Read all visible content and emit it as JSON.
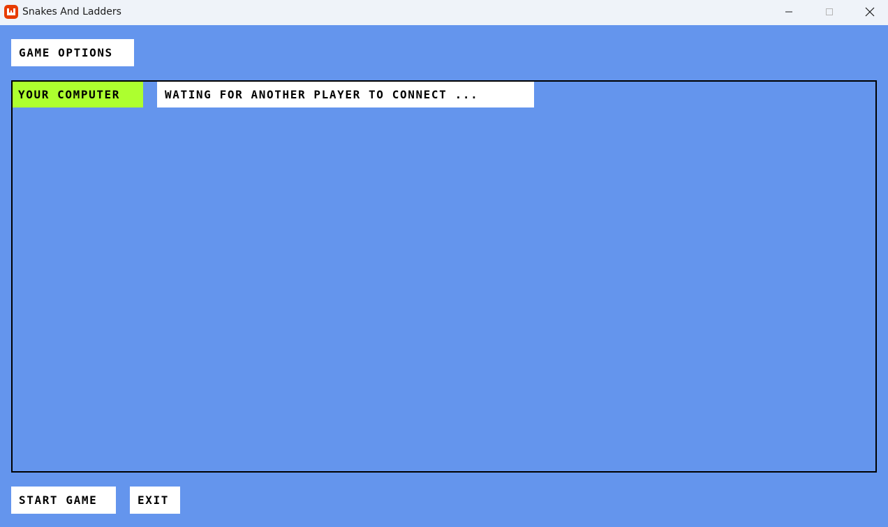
{
  "window": {
    "title": "Snakes And Ladders",
    "app_icon": "monogame-logo-icon",
    "controls": [
      "minimize-icon",
      "maximize-icon",
      "close-icon"
    ]
  },
  "menu": {
    "game_options_label": "GAME OPTIONS"
  },
  "lobby": {
    "player_label": "YOUR COMPUTER",
    "status_text": "WATING FOR ANOTHER PLAYER TO CONNECT ..."
  },
  "footer": {
    "start_label": "START GAME",
    "exit_label": "EXIT"
  },
  "colors": {
    "background": "#6495ED",
    "player_highlight": "#ADFF2F",
    "button_bg": "#FFFFFF",
    "app_icon": "#E73C00"
  }
}
